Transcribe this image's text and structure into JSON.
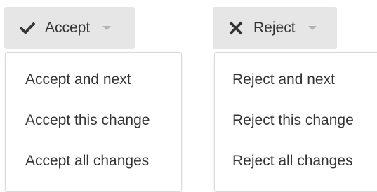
{
  "accept": {
    "button_label": "Accept",
    "icon": "check-icon",
    "items": [
      "Accept and next",
      "Accept this change",
      "Accept all changes"
    ]
  },
  "reject": {
    "button_label": "Reject",
    "icon": "x-icon",
    "items": [
      "Reject and next",
      "Reject this change",
      "Reject all changes"
    ]
  },
  "colors": {
    "button_bg": "#e6e6e6",
    "text": "#333333",
    "caret": "#b3b3b3",
    "menu_border": "#d9d9d9"
  }
}
